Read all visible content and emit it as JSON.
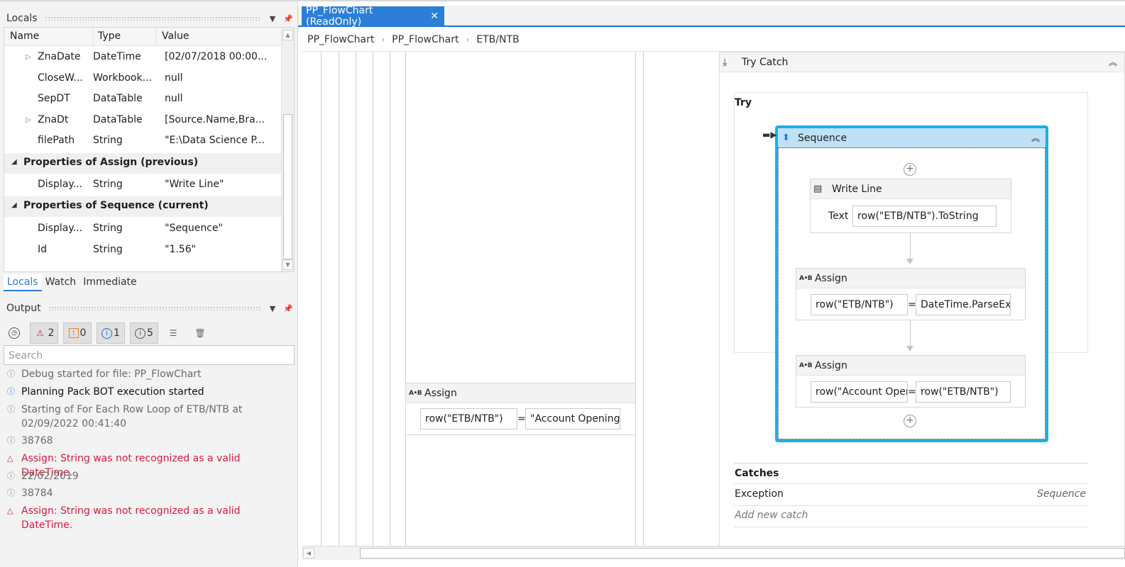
{
  "locals": {
    "title": "Locals",
    "columns": [
      "Name",
      "Type",
      "Value"
    ],
    "rows": [
      {
        "name": "ZnaDate",
        "type": "DateTime",
        "value": "[02/07/2018 00:00..."
      },
      {
        "name": "CloseW...",
        "type": "Workbook...",
        "value": "null"
      },
      {
        "name": "SepDT",
        "type": "DataTable",
        "value": "null"
      },
      {
        "name": "ZnaDt",
        "type": "DataTable",
        "value": "[Source.Name,Bra..."
      },
      {
        "name": "filePath",
        "type": "String",
        "value": "\"E:\\Data Science P..."
      }
    ],
    "section1": "Properties of Assign (previous)",
    "section1_rows": [
      {
        "name": "Display...",
        "type": "String",
        "value": "\"Write Line\""
      }
    ],
    "section2": "Properties of Sequence (current)",
    "section2_rows": [
      {
        "name": "Display...",
        "type": "String",
        "value": "\"Sequence\""
      },
      {
        "name": "Id",
        "type": "String",
        "value": "\"1.56\""
      }
    ]
  },
  "bottom_tabs": [
    "Locals",
    "Watch",
    "Immediate"
  ],
  "output": {
    "title": "Output",
    "counts": {
      "errors": "2",
      "warnings": "0",
      "info": "1",
      "trace": "5"
    },
    "search_placeholder": "Search",
    "lines": [
      {
        "kind": "trace",
        "text": "Debug started for file: PP_FlowChart"
      },
      {
        "kind": "info",
        "text": "Planning Pack BOT execution started"
      },
      {
        "kind": "trace",
        "text": "Starting of For Each Row Loop of ETB/NTB at"
      },
      {
        "kind": "trace-cont",
        "text": "02/09/2022 00:41:40"
      },
      {
        "kind": "trace",
        "text": "38768"
      },
      {
        "kind": "error",
        "text": "Assign: String was not recognized as a valid DateTime."
      },
      {
        "kind": "trace",
        "text": "22/02/2019"
      },
      {
        "kind": "trace",
        "text": "38784"
      },
      {
        "kind": "error",
        "text": "Assign: String was not recognized as a valid DateTime."
      }
    ]
  },
  "designer": {
    "tab_title": "PP_FlowChart (ReadOnly)",
    "breadcrumbs": [
      "PP_FlowChart",
      "PP_FlowChart",
      "ETB/NTB"
    ],
    "left_assign": {
      "title": "Assign",
      "to": "row(\"ETB/NTB\")",
      "value": "\"Account Opening"
    },
    "try_catch": {
      "title": "Try Catch",
      "try_label": "Try",
      "sequence_title": "Sequence",
      "write_line": {
        "title": "Write Line",
        "field_label": "Text",
        "text": "row(\"ETB/NTB\").ToString"
      },
      "assign1": {
        "title": "Assign",
        "to": "row(\"ETB/NTB\")",
        "value": "DateTime.ParseExa"
      },
      "assign2": {
        "title": "Assign",
        "to": "row(\"Account Oper",
        "value": "row(\"ETB/NTB\")"
      },
      "catches_label": "Catches",
      "catch_exception": "Exception",
      "catch_handler": "Sequence",
      "add_catch": "Add new catch"
    }
  },
  "colors": {
    "accent": "#2c7fd6",
    "error": "#d81a3c",
    "selection": "#1ab0e8"
  }
}
